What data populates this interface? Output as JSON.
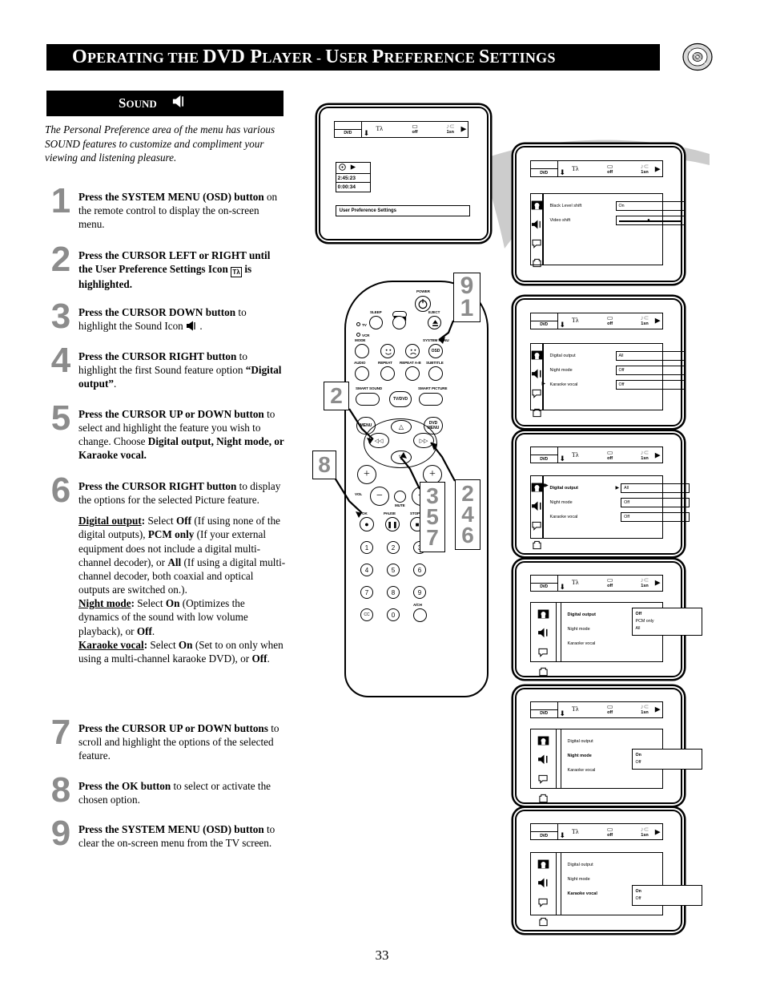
{
  "header": {
    "title_parts": [
      "O",
      "PERATING THE ",
      "DVD P",
      "LAYER - ",
      "U",
      "SER ",
      "P",
      "REFERENCE ",
      "S",
      "ETTINGS"
    ],
    "title_plain": "Operating the DVD Player - User Preference Settings",
    "disc_icon": "dvd-disc-icon"
  },
  "page_number": "33",
  "sound_section": {
    "label_first": "S",
    "label_rest": "OUND",
    "icon": "sound-speaker-icon"
  },
  "intro": "The Personal Preference area of the menu has various SOUND features to customize and compliment your viewing and listening pleasure.",
  "steps": [
    {
      "num": "1",
      "html": "<b>Press the SYSTEM MENU (OSD) button</b> on the remote control to display the on-screen menu."
    },
    {
      "num": "2",
      "html": "<b>Press the CURSOR LEFT or RIGHT until the User Preference Settings Icon</b> <span class='ico-upref' data-name='user-preference-icon'>T&#955;</span> <b>is highlighted.</b>"
    },
    {
      "num": "3",
      "html": "<b>Press the CURSOR DOWN button</b> to highlight the Sound Icon <span class='ico-sound-inline' data-name='sound-speaker-icon'><svg viewBox='0 0 14 13' width='14' height='13'><polygon points='1,4 4,4 9,0.5 9,12.5 4,9 1,9' fill='#000'/><line x1='11' y1='2' x2='11' y2='11' stroke='#000' stroke-width='1.3'/></svg></span> ."
    },
    {
      "num": "4",
      "html": "<b>Press the CURSOR RIGHT button</b> to highlight the first Sound feature option <b>&ldquo;Digital output&rdquo;</b>."
    },
    {
      "num": "5",
      "html": "<b>Press the CURSOR UP or DOWN button</b> to select and highlight the feature you wish to change. Choose <b>Digital output, Night mode, or Karaoke vocal.</b>"
    },
    {
      "num": "6",
      "html": "<b>Press the CURSOR RIGHT button</b> to display the options for the selected Picture feature.",
      "sub_html": "<u><b>Digital output</b></u><b>:</b> Select <b>Off</b> (If using none of the digital outputs), <b>PCM only</b> (If your external equipment does not include a digital multi-channel decoder), or <b>All</b> (If using a digital multi-channel decoder, both coaxial and optical outputs are switched on.).<br><u><b>Night mode</b></u><b>:</b> Select <b>On</b> (Optimizes the dynamics of the sound with low volume playback), or <b>Off</b>.<br><u><b>Karaoke vocal</b></u><b>:</b> Select <b>On</b> (Set to on only when using a multi-channel karaoke DVD), or <b>Off</b>."
    },
    {
      "num": "7",
      "html": "<b>Press the CURSOR UP or DOWN buttons</b> to scroll and highlight the options of the selected feature."
    },
    {
      "num": "8",
      "html": "<b>Press the OK button</b> to select or activate the chosen option."
    },
    {
      "num": "9",
      "html": "<b>Press the SYSTEM MENU (OSD) button</b> to clear the on-screen menu from the TV screen."
    }
  ],
  "menubar": {
    "dvd_tag": "DVD",
    "cells": [
      {
        "icon": "user-preference-icon",
        "glyph": "Tλ",
        "label": ""
      },
      {
        "icon": "tv-screen-icon",
        "glyph": "▭",
        "label": "off"
      },
      {
        "icon": "sound-wave-icon",
        "glyph": "♪⊂",
        "label": "1sn"
      }
    ]
  },
  "tv_screens": [
    {
      "name": "main-osd-screen",
      "status": {
        "disc_tag": "DVD",
        "play_tag": "play",
        "total_time": "2:45:23",
        "elapsed_time": "0:00:34"
      },
      "bottom_label": "User Preference Settings"
    },
    {
      "name": "picture-settings-screen",
      "highlight_category": 0,
      "rows": [
        {
          "name": "Black Level shift",
          "value": "On",
          "type": "value"
        },
        {
          "name": "Video shift",
          "value": "",
          "type": "slider"
        }
      ]
    },
    {
      "name": "sound-settings-screen",
      "highlight_category": 1,
      "rows": [
        {
          "name": "Digital output",
          "value": "All",
          "type": "value"
        },
        {
          "name": "Night mode",
          "value": "Off",
          "type": "value"
        },
        {
          "name": "Karaoke vocal",
          "value": "Off",
          "type": "value"
        }
      ]
    },
    {
      "name": "sound-digital-output-highlighted-screen",
      "highlight_category": 1,
      "highlight_row": 0,
      "rows": [
        {
          "name": "Digital output",
          "value": "All",
          "type": "value"
        },
        {
          "name": "Night mode",
          "value": "Off",
          "type": "value"
        },
        {
          "name": "Karaoke vocal",
          "value": "Off",
          "type": "value"
        }
      ]
    },
    {
      "name": "digital-output-options-screen",
      "highlight_category": 1,
      "highlight_row": 0,
      "rows": [
        {
          "name": "Digital output"
        },
        {
          "name": "Night mode"
        },
        {
          "name": "Karaoke vocal"
        }
      ],
      "popup": {
        "options": [
          "Off",
          "PCM only",
          "All"
        ],
        "selected": "Off"
      }
    },
    {
      "name": "night-mode-options-screen",
      "highlight_category": 1,
      "highlight_row": 1,
      "rows": [
        {
          "name": "Digital output"
        },
        {
          "name": "Night mode"
        },
        {
          "name": "Karaoke vocal"
        }
      ],
      "popup": {
        "options": [
          "On",
          "Off"
        ],
        "selected": "On"
      }
    },
    {
      "name": "karaoke-vocal-options-screen",
      "highlight_category": 1,
      "highlight_row": 2,
      "rows": [
        {
          "name": "Digital output"
        },
        {
          "name": "Night mode"
        },
        {
          "name": "Karaoke vocal"
        }
      ],
      "popup": {
        "options": [
          "On",
          "Off"
        ],
        "selected": "On"
      }
    }
  ],
  "remote": {
    "labels": {
      "power": "POWER",
      "sleep": "SLEEP",
      "eject": "EJECT",
      "tv": "TV",
      "vcr": "VCR",
      "mode": "MODE",
      "system_menu": "SYSTEM MENU",
      "osd": "OSD",
      "audio": "AUDIO",
      "repeat": "REPEAT",
      "repeat_ab": "REPEAT A-B",
      "subtitle": "SUBTITLE",
      "smart_sound": "SMART SOUND",
      "tv_dvd": "TV/DVD",
      "smart_picture": "SMART PICTURE",
      "menu": "MENU",
      "dvd_menu_1": "DVD",
      "dvd_menu_2": "MENU",
      "vol": "VOL",
      "mute": "MUTE",
      "ok": "OK",
      "pause": "PAUSE",
      "stop": "STOP",
      "cc": "CC",
      "ach": "A/CH"
    },
    "keypad": [
      "1",
      "2",
      "3",
      "4",
      "5",
      "6",
      "7",
      "8",
      "9",
      "0"
    ]
  },
  "callouts": [
    {
      "name": "callout-9-1",
      "lines": [
        "9",
        "1"
      ]
    },
    {
      "name": "callout-2",
      "lines": [
        "2"
      ]
    },
    {
      "name": "callout-8",
      "lines": [
        "8"
      ]
    },
    {
      "name": "callout-3-5-7",
      "lines": [
        "3",
        "5",
        "7"
      ]
    },
    {
      "name": "callout-2-4-6",
      "lines": [
        "2",
        "4",
        "6"
      ]
    }
  ],
  "colors": {
    "header_bg": "#000000",
    "header_text": "#ffffff",
    "step_number": "#8c8c8c",
    "swoosh": "#cccccc"
  }
}
